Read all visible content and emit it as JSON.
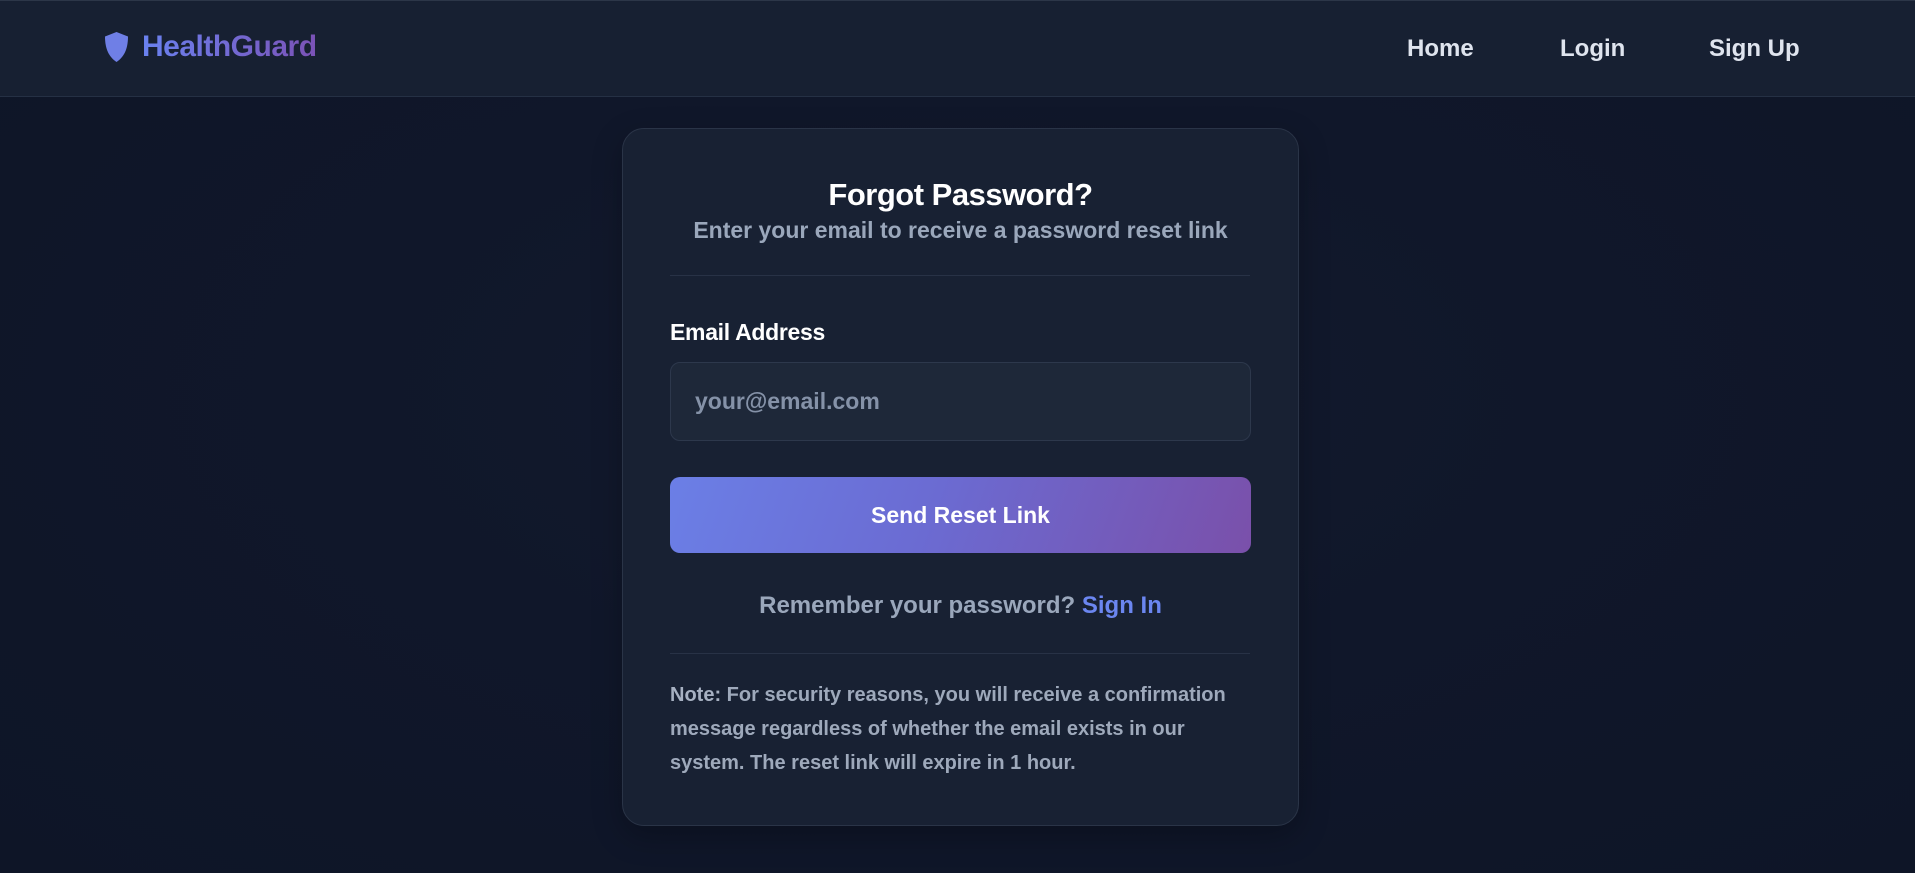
{
  "header": {
    "brand": {
      "name": "HealthGuard",
      "icon": "shield-icon"
    },
    "nav": [
      "Home",
      "Login",
      "Sign Up"
    ]
  },
  "card": {
    "title": "Forgot Password?",
    "subtitle": "Enter your email to receive a password reset link",
    "email_label": "Email Address",
    "email_placeholder": "your@email.com",
    "email_value": "",
    "submit_label": "Send Reset Link",
    "remember_text": "Remember your password?",
    "signin_link": "Sign In",
    "note_label": "Note:",
    "note_text": "For security reasons, you will receive a confirmation message regardless of whether the email exists in our system. The reset link will expire in 1 hour."
  },
  "colors": {
    "background": "#10172a",
    "header": "#172032",
    "card": "#182133",
    "accent_start": "#667eea",
    "accent_end": "#764ba2",
    "link": "#6b86f0"
  }
}
